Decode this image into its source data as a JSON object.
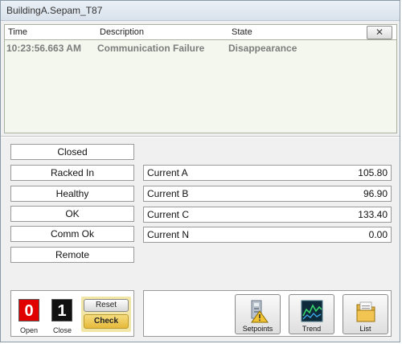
{
  "window": {
    "title": "BuildingA.Sepam_T87"
  },
  "events": {
    "columns": {
      "time": "Time",
      "description": "Description",
      "state": "State"
    },
    "close_glyph": "✕",
    "rows": [
      {
        "time": "10:23:56.663 AM",
        "description": "Communication Failure",
        "state": "Disappearance"
      }
    ]
  },
  "status": {
    "items": [
      "Closed",
      "Racked In",
      "Healthy",
      "OK",
      "Comm Ok",
      "Remote"
    ]
  },
  "measurements": [
    {
      "label": "Current A",
      "value": "105.80"
    },
    {
      "label": "Current B",
      "value": "96.90"
    },
    {
      "label": "Current C",
      "value": "133.40"
    },
    {
      "label": "Current N",
      "value": "0.00"
    }
  ],
  "controls": {
    "open": {
      "value": "0",
      "caption": "Open",
      "color": "#e00000"
    },
    "close": {
      "value": "1",
      "caption": "Close",
      "color": "#111111"
    },
    "reset_label": "Reset",
    "check_label": "Check",
    "highlight_color": "#f1e6a6"
  },
  "tools": [
    {
      "label": "Setpoints",
      "icon": "setpoints-icon"
    },
    {
      "label": "Trend",
      "icon": "trend-chart-icon"
    },
    {
      "label": "List",
      "icon": "folder-list-icon"
    }
  ]
}
